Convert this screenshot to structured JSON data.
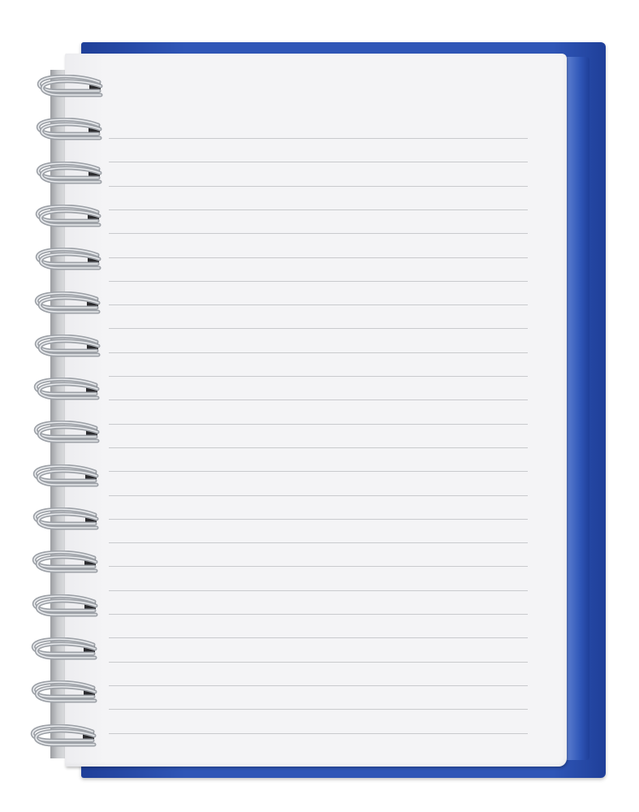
{
  "image": {
    "subject": "spiral notebook",
    "colors": {
      "background": "#ffffff",
      "cover": "#2f56b7",
      "cover_dark": "#1f3f99",
      "paper": "#f4f4f6",
      "rule_line": "#c9cacd",
      "wire": "#9ea2a8",
      "wire_highlight": "#e9ebee"
    },
    "notebook": {
      "ruled_line_count": 26,
      "coil_count": 16
    }
  }
}
